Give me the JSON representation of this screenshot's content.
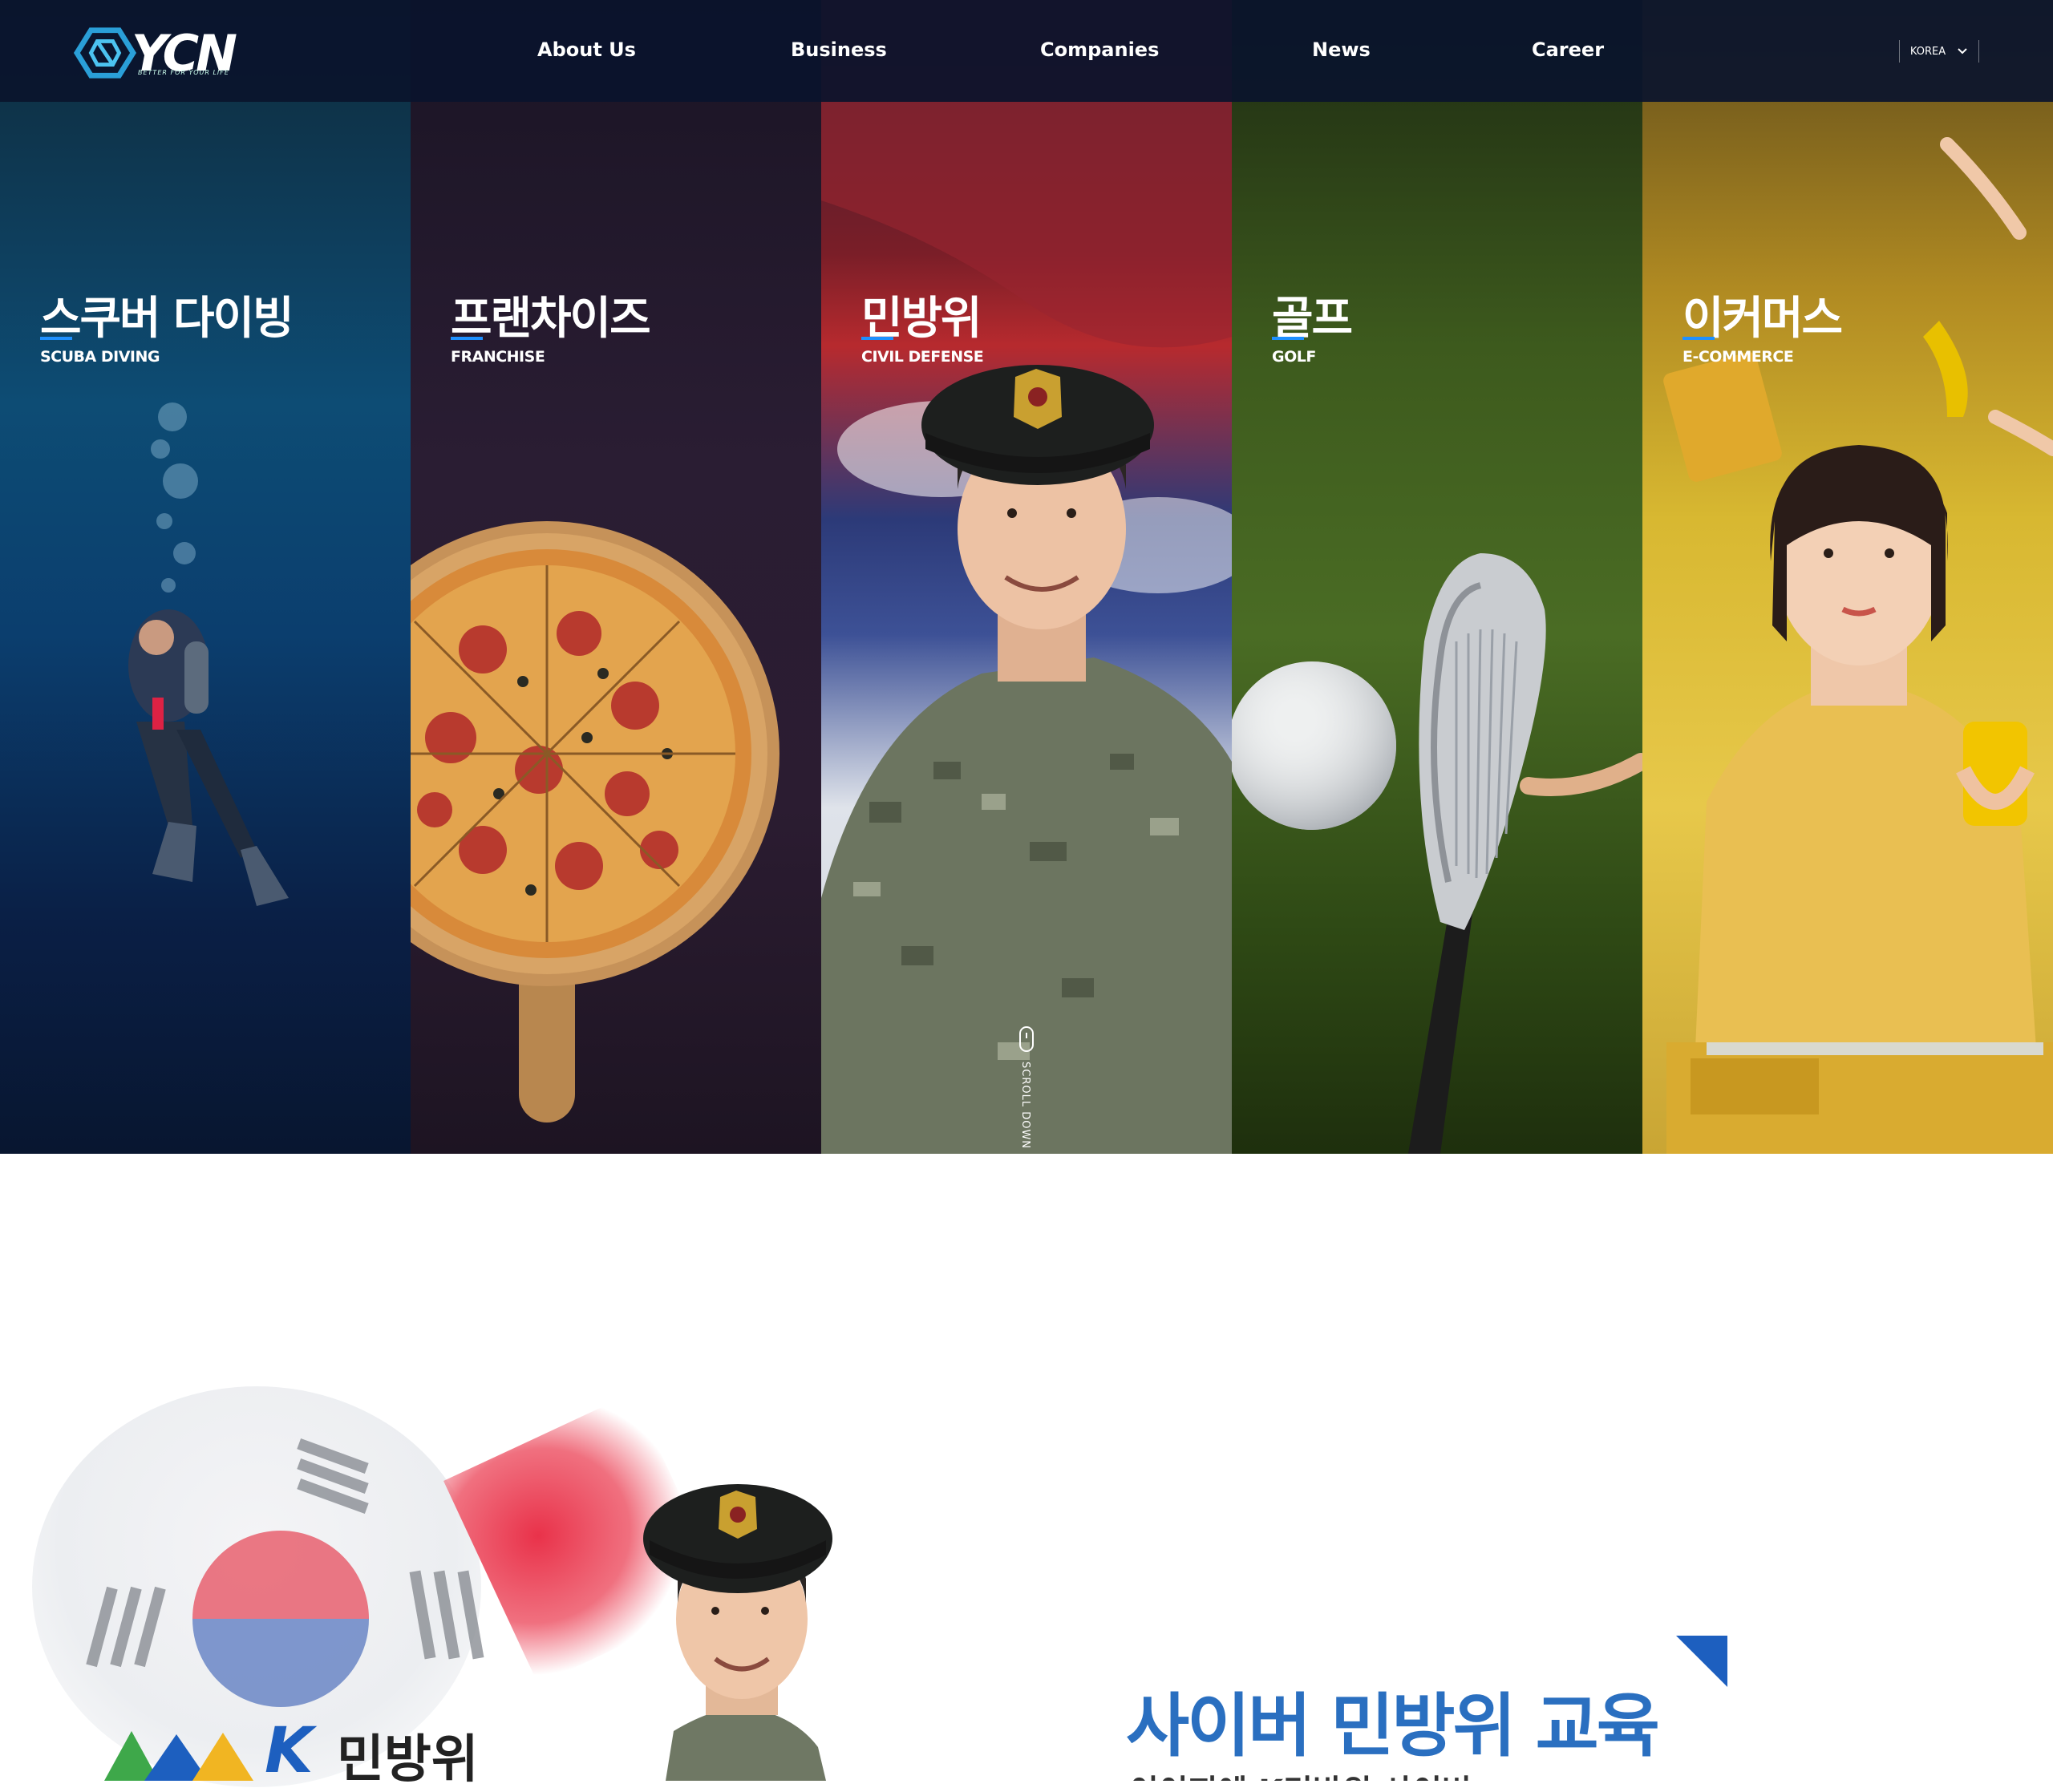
{
  "header": {
    "logo_text": "YCN",
    "logo_tagline": "BETTER FOR YOUR LIFE",
    "nav": [
      {
        "label": "About Us"
      },
      {
        "label": "Business"
      },
      {
        "label": "Companies"
      },
      {
        "label": "News"
      },
      {
        "label": "Career"
      }
    ],
    "language": "KOREA"
  },
  "hero": {
    "panels": [
      {
        "title": "스쿠버 다이빙",
        "subtitle": "SCUBA DIVING"
      },
      {
        "title": "프랜차이즈",
        "subtitle": "FRANCHISE"
      },
      {
        "title": "민방위",
        "subtitle": "CIVIL DEFENSE"
      },
      {
        "title": "골프",
        "subtitle": "GOLF"
      },
      {
        "title": "이커머스",
        "subtitle": "E-COMMERCE"
      }
    ],
    "scroll_label": "SCROLL DOWN"
  },
  "section2": {
    "brand_k": "K",
    "brand_text": "민방위",
    "title": "사이버 민방위 교육",
    "subtitle": "이이지에 K민방위 사이버"
  },
  "colors": {
    "accent": "#1e90ff",
    "title_blue": "#2a6fc0",
    "header_bg": "#0a142d"
  }
}
